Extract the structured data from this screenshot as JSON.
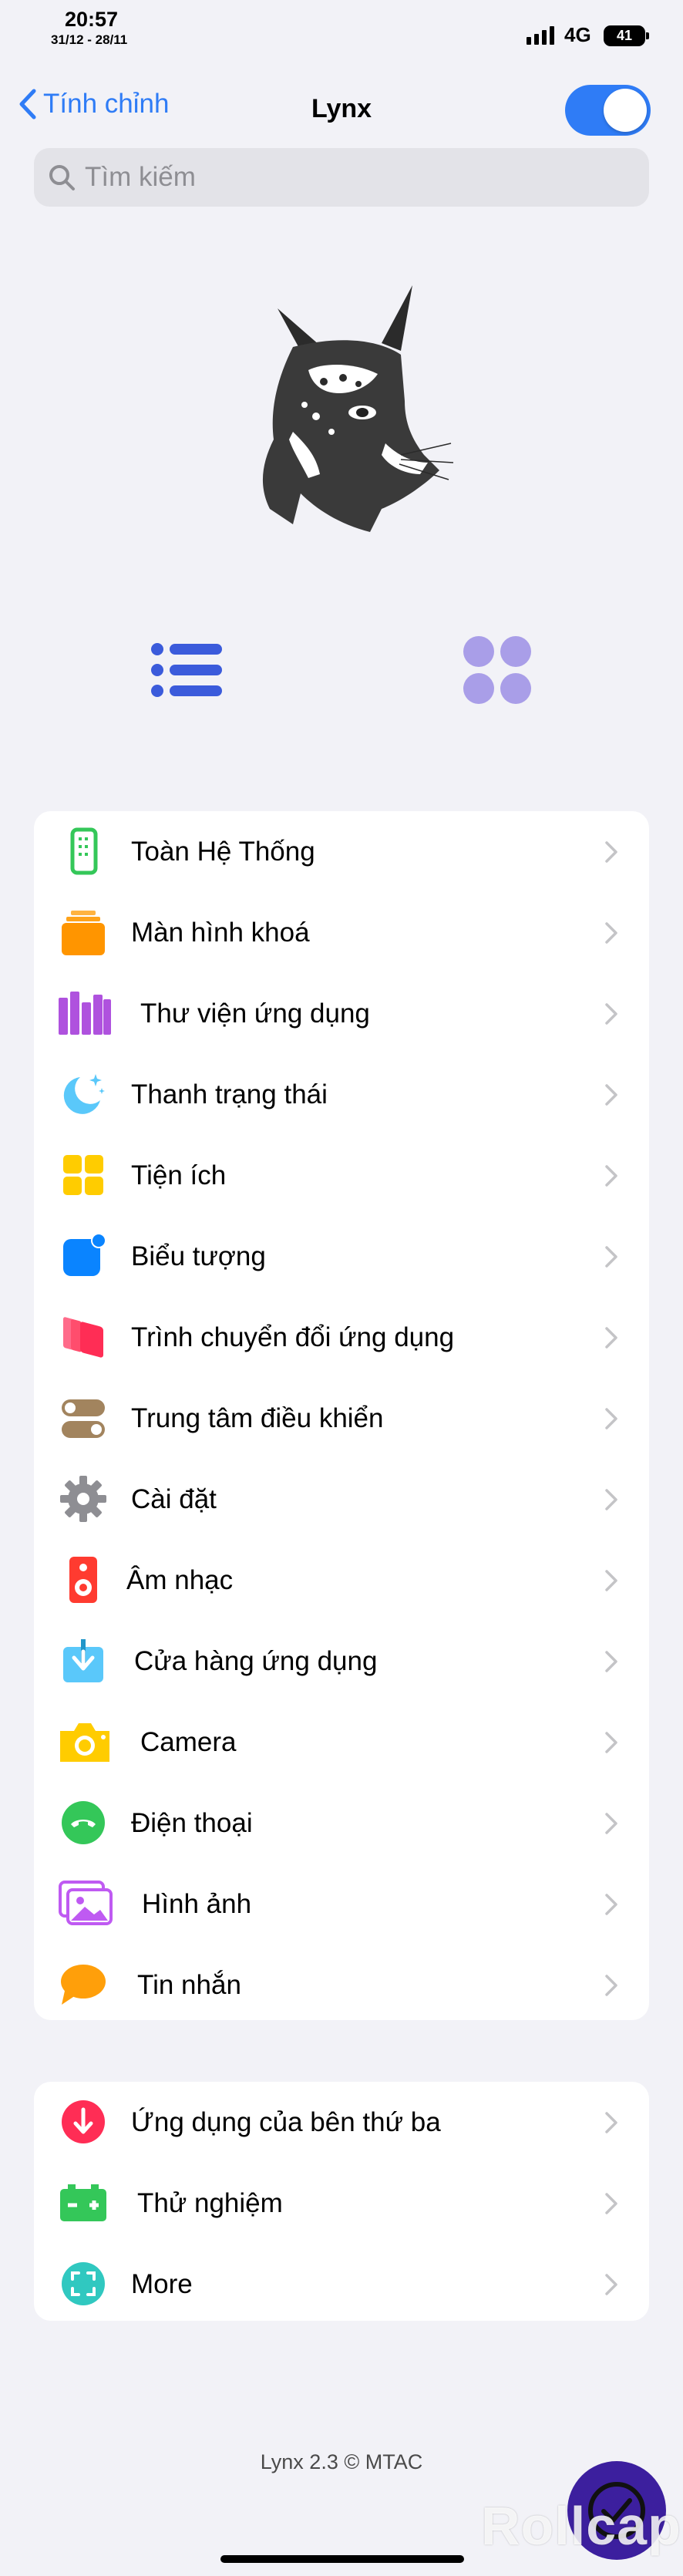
{
  "status_bar": {
    "time": "20:57",
    "date": "31/12 - 28/11",
    "network": "4G",
    "battery": "41"
  },
  "nav": {
    "back_label": "Tính chỉnh",
    "title": "Lynx",
    "toggle_on": true
  },
  "search": {
    "placeholder": "Tìm kiếm"
  },
  "icons": {
    "back": "chevron-left-icon",
    "search": "magnifier-icon",
    "list_view": "list-view-icon",
    "grid_view": "grid-view-icon",
    "fab": "checkmark-icon"
  },
  "colors": {
    "accent": "#2f7cf6",
    "background": "#f2f2f7",
    "card": "#ffffff"
  },
  "main_menu": [
    {
      "label": "Toàn Hệ Thống",
      "icon": "phone-icon"
    },
    {
      "label": "Màn hình khoá",
      "icon": "lock-screen-icon"
    },
    {
      "label": "Thư viện ứng dụng",
      "icon": "books-icon"
    },
    {
      "label": "Thanh trạng thái",
      "icon": "moon-stars-icon"
    },
    {
      "label": "Tiện ích",
      "icon": "widgets-icon"
    },
    {
      "label": "Biểu tượng",
      "icon": "badge-icon"
    },
    {
      "label": "Trình chuyển đổi ứng dụng",
      "icon": "app-switcher-icon"
    },
    {
      "label": "Trung tâm điều khiển",
      "icon": "toggles-icon"
    },
    {
      "label": "Cài đặt",
      "icon": "gear-icon"
    },
    {
      "label": "Âm nhạc",
      "icon": "speaker-icon"
    },
    {
      "label": "Cửa hàng ứng dụng",
      "icon": "download-icon"
    },
    {
      "label": "Camera",
      "icon": "camera-icon"
    },
    {
      "label": "Điện thoại",
      "icon": "phone-call-icon"
    },
    {
      "label": "Hình ảnh",
      "icon": "photos-icon"
    },
    {
      "label": "Tin nhắn",
      "icon": "message-icon"
    }
  ],
  "extra_menu": [
    {
      "label": "Ứng dụng của bên thứ ba",
      "icon": "arrow-down-circle-icon"
    },
    {
      "label": "Thử nghiệm",
      "icon": "battery-test-icon"
    },
    {
      "label": "More",
      "icon": "viewfinder-icon"
    }
  ],
  "footer": {
    "text": "Lynx 2.3 © MTAC"
  },
  "watermark": "Rollcap"
}
